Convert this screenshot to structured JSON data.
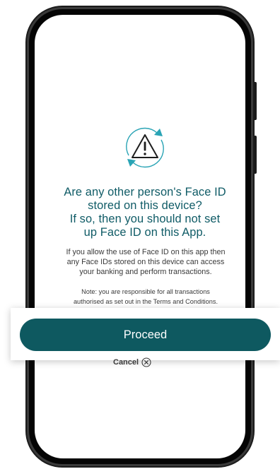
{
  "dialog": {
    "title_lines": [
      "Are any other person's Face ID",
      "stored on this device?",
      "If so, then you should not set",
      "up Face ID on this App."
    ],
    "body_lines": [
      "If you allow the use of Face ID on this app then",
      "any Face IDs stored on this device can access",
      "your banking and perform transactions."
    ],
    "note_lines": [
      "Note: you are responsible for all transactions",
      "authorised as set out in the Terms and Conditions."
    ],
    "icon": "warning-refresh-icon"
  },
  "actions": {
    "proceed_label": "Proceed",
    "cancel_label": "Cancel",
    "cancel_icon": "close-circle-icon"
  },
  "colors": {
    "accent": "#0e5960",
    "title": "#0f5b66",
    "icon_accent": "#2aa4b5",
    "text": "#3a3a3a"
  }
}
